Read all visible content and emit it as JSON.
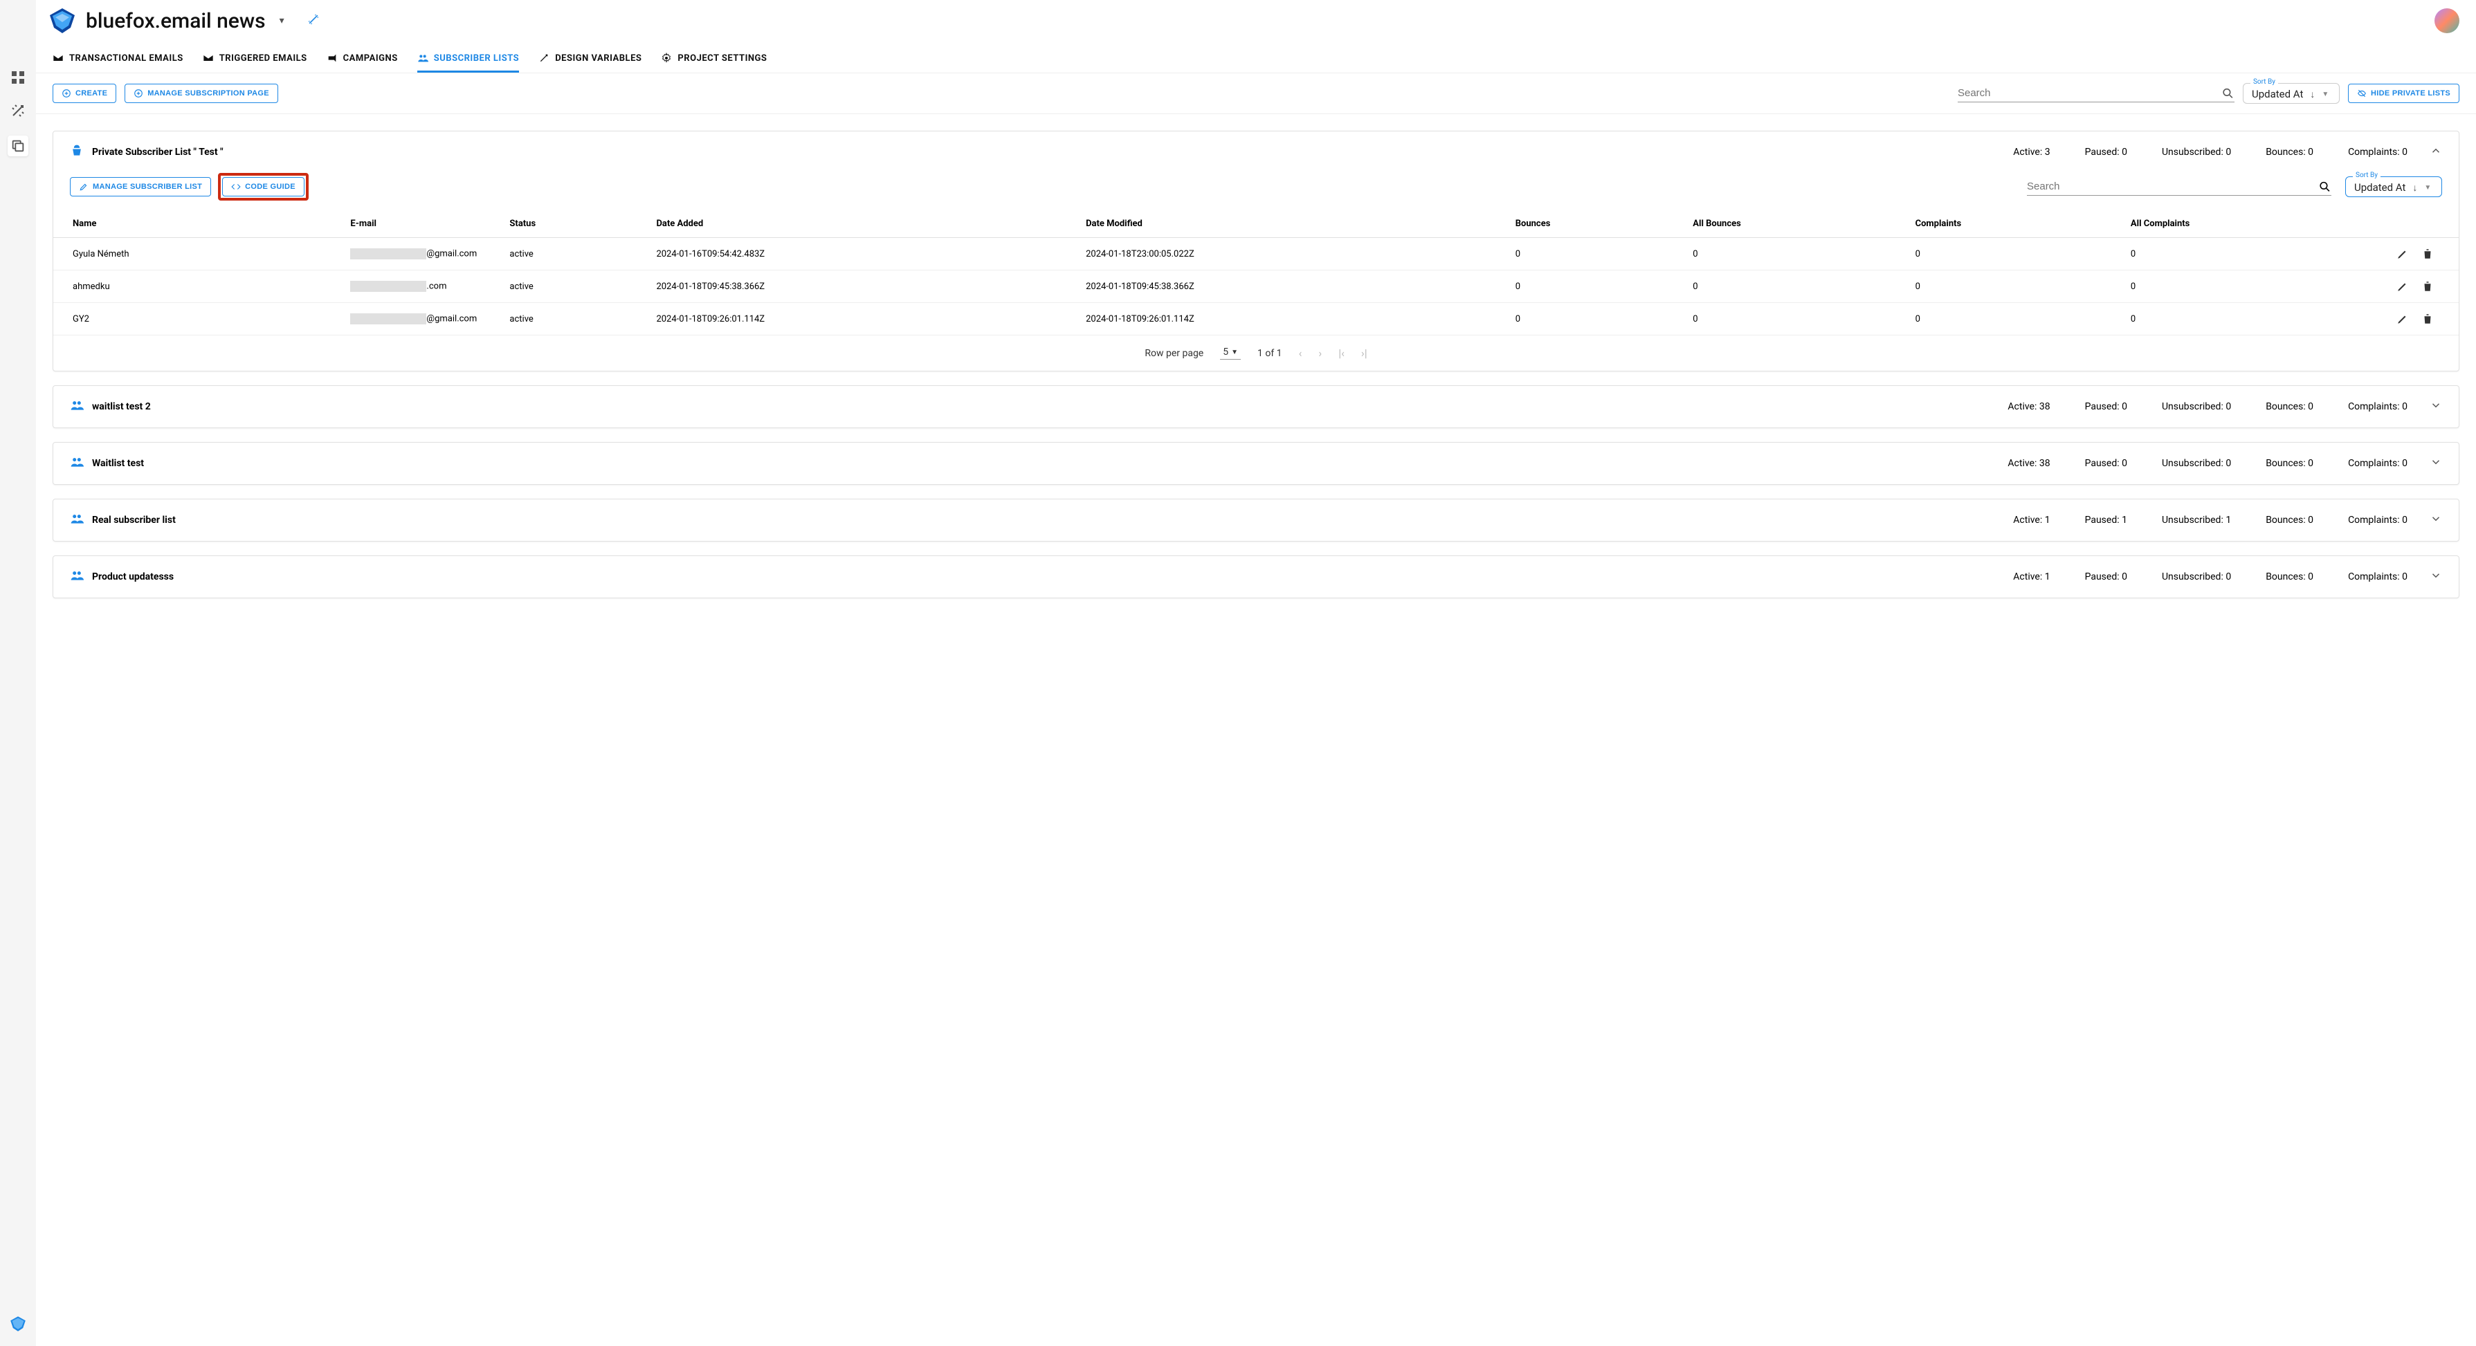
{
  "project_title": "bluefox.email news",
  "tabs": [
    {
      "label": "TRANSACTIONAL EMAILS"
    },
    {
      "label": "TRIGGERED EMAILS"
    },
    {
      "label": "CAMPAIGNS"
    },
    {
      "label": "SUBSCRIBER LISTS"
    },
    {
      "label": "DESIGN VARIABLES"
    },
    {
      "label": "PROJECT SETTINGS"
    }
  ],
  "toolbar": {
    "create": "CREATE",
    "manage_page": "MANAGE SUBSCRIPTION PAGE",
    "search_placeholder": "Search",
    "sort_label": "Sort By",
    "sort_value": "Updated At",
    "hide_private": "HIDE PRIVATE LISTS"
  },
  "open_list": {
    "title": "Private Subscriber List \" Test \"",
    "stats": {
      "active": "Active: 3",
      "paused": "Paused: 0",
      "unsub": "Unsubscribed: 0",
      "bounces": "Bounces: 0",
      "complaints": "Complaints: 0"
    },
    "manage_btn": "MANAGE SUBSCRIBER LIST",
    "code_btn": "CODE GUIDE",
    "search_placeholder": "Search",
    "sort_label": "Sort By",
    "sort_value": "Updated At",
    "columns": [
      "Name",
      "E-mail",
      "Status",
      "Date Added",
      "Date Modified",
      "Bounces",
      "All Bounces",
      "Complaints",
      "All Complaints"
    ],
    "rows": [
      {
        "name": "Gyula Németh",
        "email_suffix": "@gmail.com",
        "status": "active",
        "added": "2024-01-16T09:54:42.483Z",
        "modified": "2024-01-18T23:00:05.022Z",
        "b": "0",
        "ab": "0",
        "c": "0",
        "ac": "0"
      },
      {
        "name": "ahmedku",
        "email_suffix": ".com",
        "status": "active",
        "added": "2024-01-18T09:45:38.366Z",
        "modified": "2024-01-18T09:45:38.366Z",
        "b": "0",
        "ab": "0",
        "c": "0",
        "ac": "0"
      },
      {
        "name": "GY2",
        "email_suffix": "@gmail.com",
        "status": "active",
        "added": "2024-01-18T09:26:01.114Z",
        "modified": "2024-01-18T09:26:01.114Z",
        "b": "0",
        "ab": "0",
        "c": "0",
        "ac": "0"
      }
    ],
    "pager": {
      "rpp_label": "Row per page",
      "rpp_value": "5",
      "range": "1 of 1"
    }
  },
  "collapsed_lists": [
    {
      "title": "waitlist test 2",
      "active": "Active: 38",
      "paused": "Paused: 0",
      "unsub": "Unsubscribed: 0",
      "bounces": "Bounces: 0",
      "complaints": "Complaints: 0"
    },
    {
      "title": "Waitlist test",
      "active": "Active: 38",
      "paused": "Paused: 0",
      "unsub": "Unsubscribed: 0",
      "bounces": "Bounces: 0",
      "complaints": "Complaints: 0"
    },
    {
      "title": "Real subscriber list",
      "active": "Active: 1",
      "paused": "Paused: 1",
      "unsub": "Unsubscribed: 1",
      "bounces": "Bounces: 0",
      "complaints": "Complaints: 0"
    },
    {
      "title": "Product updatesss",
      "active": "Active: 1",
      "paused": "Paused: 0",
      "unsub": "Unsubscribed: 0",
      "bounces": "Bounces: 0",
      "complaints": "Complaints: 0"
    }
  ]
}
